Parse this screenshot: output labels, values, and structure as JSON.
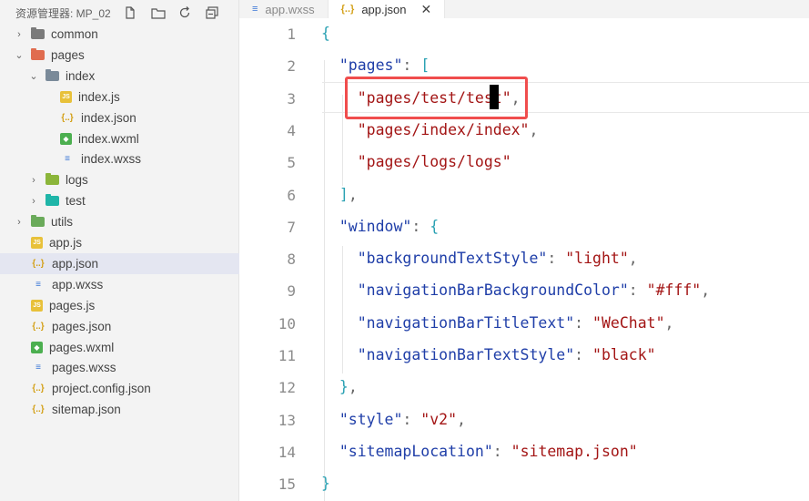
{
  "sidebar": {
    "title": "资源管理器: MP_02",
    "items": [
      {
        "label": "common",
        "kind": "folder",
        "color": "#7a7a7a",
        "chevron": "›"
      },
      {
        "label": "pages",
        "kind": "folder",
        "color": "#e06c4f",
        "chevron": "⌄"
      },
      {
        "label": "index",
        "kind": "folder",
        "color": "#7a8a99",
        "chevron": "⌄"
      },
      {
        "label": "index.js",
        "kind": "js",
        "color": "#e8c13a"
      },
      {
        "label": "index.json",
        "kind": "json",
        "color": "#d4a11a"
      },
      {
        "label": "index.wxml",
        "kind": "wxml",
        "color": "#4caf50"
      },
      {
        "label": "index.wxss",
        "kind": "wxss",
        "color": "#3a76d6"
      },
      {
        "label": "logs",
        "kind": "folder",
        "color": "#8bb53a",
        "chevron": "›"
      },
      {
        "label": "test",
        "kind": "folder",
        "color": "#1fb5a8",
        "chevron": "›"
      },
      {
        "label": "utils",
        "kind": "folder",
        "color": "#6aaa5a",
        "chevron": "›"
      },
      {
        "label": "app.js",
        "kind": "js",
        "color": "#e8c13a"
      },
      {
        "label": "app.json",
        "kind": "json",
        "color": "#d4a11a"
      },
      {
        "label": "app.wxss",
        "kind": "wxss",
        "color": "#3a76d6"
      },
      {
        "label": "pages.js",
        "kind": "js",
        "color": "#e8c13a"
      },
      {
        "label": "pages.json",
        "kind": "json",
        "color": "#d4a11a"
      },
      {
        "label": "pages.wxml",
        "kind": "wxml",
        "color": "#4caf50"
      },
      {
        "label": "pages.wxss",
        "kind": "wxss",
        "color": "#3a76d6"
      },
      {
        "label": "project.config.json",
        "kind": "json",
        "color": "#d4a11a"
      },
      {
        "label": "sitemap.json",
        "kind": "json",
        "color": "#d4a11a"
      }
    ],
    "selected": "app.json"
  },
  "tabs": [
    {
      "label": "app.wxss",
      "icon_glyph": "≡",
      "icon_color": "#3a76d6"
    },
    {
      "label": "app.json",
      "icon_glyph": "{..}",
      "icon_color": "#d4a11a",
      "close_glyph": "✕"
    }
  ],
  "editor": {
    "line_numbers": [
      "1",
      "2",
      "3",
      "4",
      "5",
      "6",
      "7",
      "8",
      "9",
      "10",
      "11",
      "12",
      "13",
      "14",
      "15"
    ],
    "lines": [
      "{",
      "  \"pages\": [",
      "    \"pages/test/test\",",
      "    \"pages/index/index\",",
      "    \"pages/logs/logs\"",
      "  ],",
      "  \"window\": {",
      "    \"backgroundTextStyle\": \"light\",",
      "    \"navigationBarBackgroundColor\": \"#fff\",",
      "    \"navigationBarTitleText\": \"WeChat\",",
      "    \"navigationBarTextStyle\": \"black\"",
      "  },",
      "  \"style\": \"v2\",",
      "  \"sitemapLocation\": \"sitemap.json\"",
      "}"
    ],
    "highlight_color": "#f04d4d"
  }
}
